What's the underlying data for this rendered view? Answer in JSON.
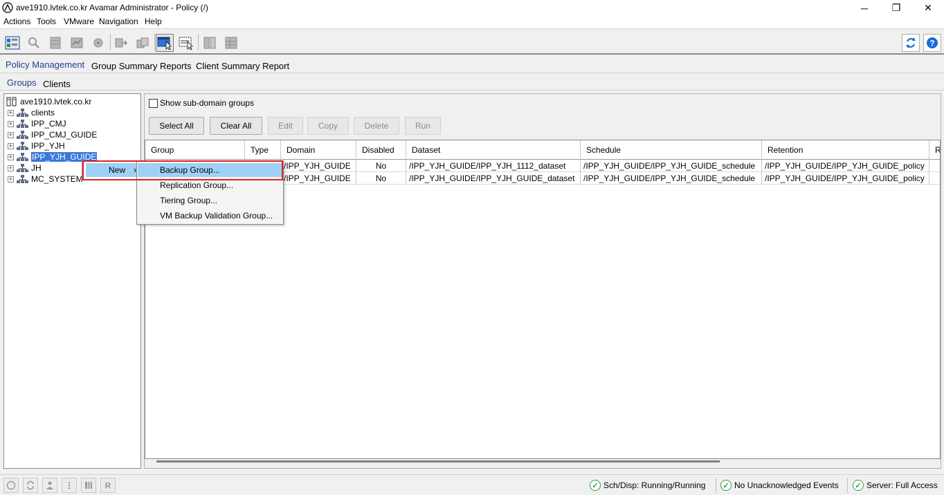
{
  "window": {
    "title": "ave1910.lvtek.co.kr Avamar Administrator - Policy (/)",
    "minimize": "─",
    "maximize": "❐",
    "close": "✕"
  },
  "menubar": [
    "Actions",
    "Tools",
    "VMware",
    "Navigation",
    "Help"
  ],
  "tabs": {
    "main": [
      "Policy Management",
      "Group Summary Reports",
      "Client Summary Report"
    ],
    "sub": [
      "Groups",
      "Clients"
    ]
  },
  "tree": {
    "root": "ave1910.lvtek.co.kr",
    "items": [
      "clients",
      "IPP_CMJ",
      "IPP_CMJ_GUIDE",
      "IPP_YJH",
      "IPP_YJH_GUIDE",
      "JH",
      "MC_SYSTEM"
    ],
    "selected": "IPP_YJH_GUIDE",
    "expander": "+"
  },
  "options": {
    "show_subdomain": "Show sub-domain groups",
    "show_subdomain_checked": false
  },
  "buttons": {
    "select_all": "Select All",
    "clear_all": "Clear All",
    "edit": "Edit",
    "copy": "Copy",
    "delete": "Delete",
    "run": "Run"
  },
  "table": {
    "columns": [
      "Group",
      "Type",
      "Domain",
      "Disabled",
      "Dataset",
      "Schedule",
      "Retention",
      "R"
    ],
    "rows": [
      [
        "",
        "",
        "/IPP_YJH_GUIDE",
        "No",
        "/IPP_YJH_GUIDE/IPP_YJH_1112_dataset",
        "/IPP_YJH_GUIDE/IPP_YJH_GUIDE_schedule",
        "/IPP_YJH_GUIDE/IPP_YJH_GUIDE_policy",
        ""
      ],
      [
        "",
        "",
        "/IPP_YJH_GUIDE",
        "No",
        "/IPP_YJH_GUIDE/IPP_YJH_GUIDE_dataset",
        "/IPP_YJH_GUIDE/IPP_YJH_GUIDE_schedule",
        "/IPP_YJH_GUIDE/IPP_YJH_GUIDE_policy",
        ""
      ]
    ]
  },
  "context_menu": {
    "new_label": "New",
    "arrow": "›",
    "submenu": [
      "Backup Group...",
      "Replication Group...",
      "Tiering Group...",
      "VM Backup Validation Group..."
    ],
    "highlighted": "Backup Group..."
  },
  "status": {
    "sch_disp": "Sch/Disp: Running/Running",
    "events": "No Unacknowledged Events",
    "server": "Server: Full Access",
    "ok_glyph": "✓"
  },
  "colors": {
    "selection": "#3878d8",
    "menu_highlight": "#9fd1f7",
    "annotation_box": "#e02020",
    "status_ok": "#2ea043"
  }
}
